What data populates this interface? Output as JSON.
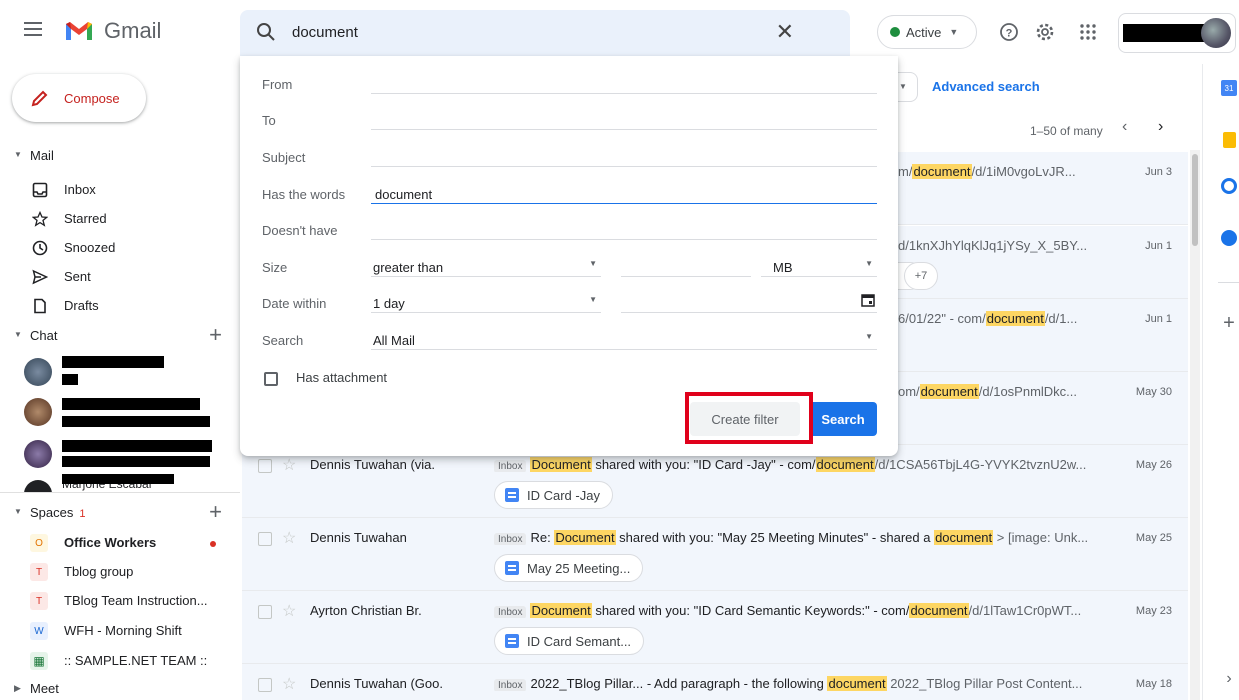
{
  "header": {
    "app_name": "Gmail",
    "search_query": "document",
    "status_label": "Active"
  },
  "sidebar": {
    "compose_label": "Compose",
    "mail_section": "Mail",
    "mail_items": [
      {
        "label": "Inbox",
        "icon": "inbox-icon"
      },
      {
        "label": "Starred",
        "icon": "star-icon"
      },
      {
        "label": "Snoozed",
        "icon": "clock-icon"
      },
      {
        "label": "Sent",
        "icon": "send-icon"
      },
      {
        "label": "Drafts",
        "icon": "draft-icon"
      }
    ],
    "chat_section": "Chat",
    "spaces_section": "Spaces",
    "spaces_count": "1",
    "spaces": [
      {
        "badge": "O",
        "label": "Office Workers"
      },
      {
        "badge": "T",
        "label": "Tblog group"
      },
      {
        "badge": "T",
        "label": "TBlog Team Instruction..."
      },
      {
        "badge": "W",
        "label": "WFH - Morning Shift"
      },
      {
        "badge": "",
        "label": ":: SAMPLE.NET TEAM ::"
      }
    ],
    "meet_section": "Meet",
    "chat_partial_name": "Marjorie Escabal"
  },
  "search_panel": {
    "from_label": "From",
    "to_label": "To",
    "subject_label": "Subject",
    "has_words_label": "Has the words",
    "has_words_value": "document",
    "doesnt_have_label": "Doesn't have",
    "size_label": "Size",
    "size_operator": "greater than",
    "size_unit": "MB",
    "date_within_label": "Date within",
    "date_within_value": "1 day",
    "search_in_label": "Search",
    "search_in_value": "All Mail",
    "has_attachment_label": "Has attachment",
    "create_filter_label": "Create filter",
    "search_button_label": "Search"
  },
  "list": {
    "advanced_search_label": "Advanced search",
    "pagination": "1–50 of many",
    "more_chips": "+7",
    "rows": [
      {
        "sender": "",
        "tag": "",
        "pre": "",
        "tail": "m/",
        "hl": "document",
        "post": "/d/1iM0vgoLvJR...",
        "date": "Jun 3",
        "attachment": ""
      },
      {
        "sender": "",
        "tag": "",
        "pre": "",
        "tail": "d/1knXJhYlqKlJq1jYSy_X_5BY...",
        "hl": "",
        "post": "",
        "date": "Jun 1",
        "attachment": ""
      },
      {
        "sender": "",
        "tag": "",
        "pre": "",
        "tail": "6/01/22\" - com/",
        "hl": "document",
        "post": "/d/1...",
        "date": "Jun 1",
        "attachment": ""
      },
      {
        "sender": "",
        "tag": "",
        "pre": "",
        "tail": "om/",
        "hl": "document",
        "post": "/d/1osPnmlDkc...",
        "date": "May 30",
        "attachment": ""
      },
      {
        "sender": "Dennis Tuwahan (via.",
        "tag": "Inbox",
        "hl1": "Document",
        "mid": " shared with you: \"ID Card -Jay\" - com/",
        "hl2": "document",
        "post": "/d/1CSA56TbjL4G-YVYK2tvznU2w...",
        "date": "May 26",
        "attachment": "ID Card -Jay"
      },
      {
        "sender": "Dennis Tuwahan",
        "tag": "Inbox",
        "pre": "Re: ",
        "hl1": "Document",
        "mid": " shared with you: \"May 25 Meeting Minutes\" - shared a ",
        "hl2": "document",
        "post": " > [image: Unk...",
        "date": "May 25",
        "attachment": "May 25 Meeting..."
      },
      {
        "sender": "Ayrton Christian Br.",
        "tag": "Inbox",
        "hl1": "Document",
        "mid": " shared with you: \"ID Card Semantic Keywords:\" - com/",
        "hl2": "document",
        "post": "/d/1lTaw1Cr0pWT...",
        "date": "May 23",
        "attachment": "ID Card Semant..."
      },
      {
        "sender": "Dennis Tuwahan (Goo.",
        "tag": "Inbox",
        "pre": "2022_TBlog Pillar... - Add paragraph - the following ",
        "hl1": "document",
        "mid": " 2022_TBlog Pillar Post Content...",
        "date": "May 18",
        "attachment": ""
      }
    ]
  },
  "colors": {
    "accent": "#1a73e8",
    "compose_red": "#c5221f",
    "highlight": "#fdd663",
    "annotation_red": "#e0001b",
    "row_bg": "#f2f6fc"
  }
}
